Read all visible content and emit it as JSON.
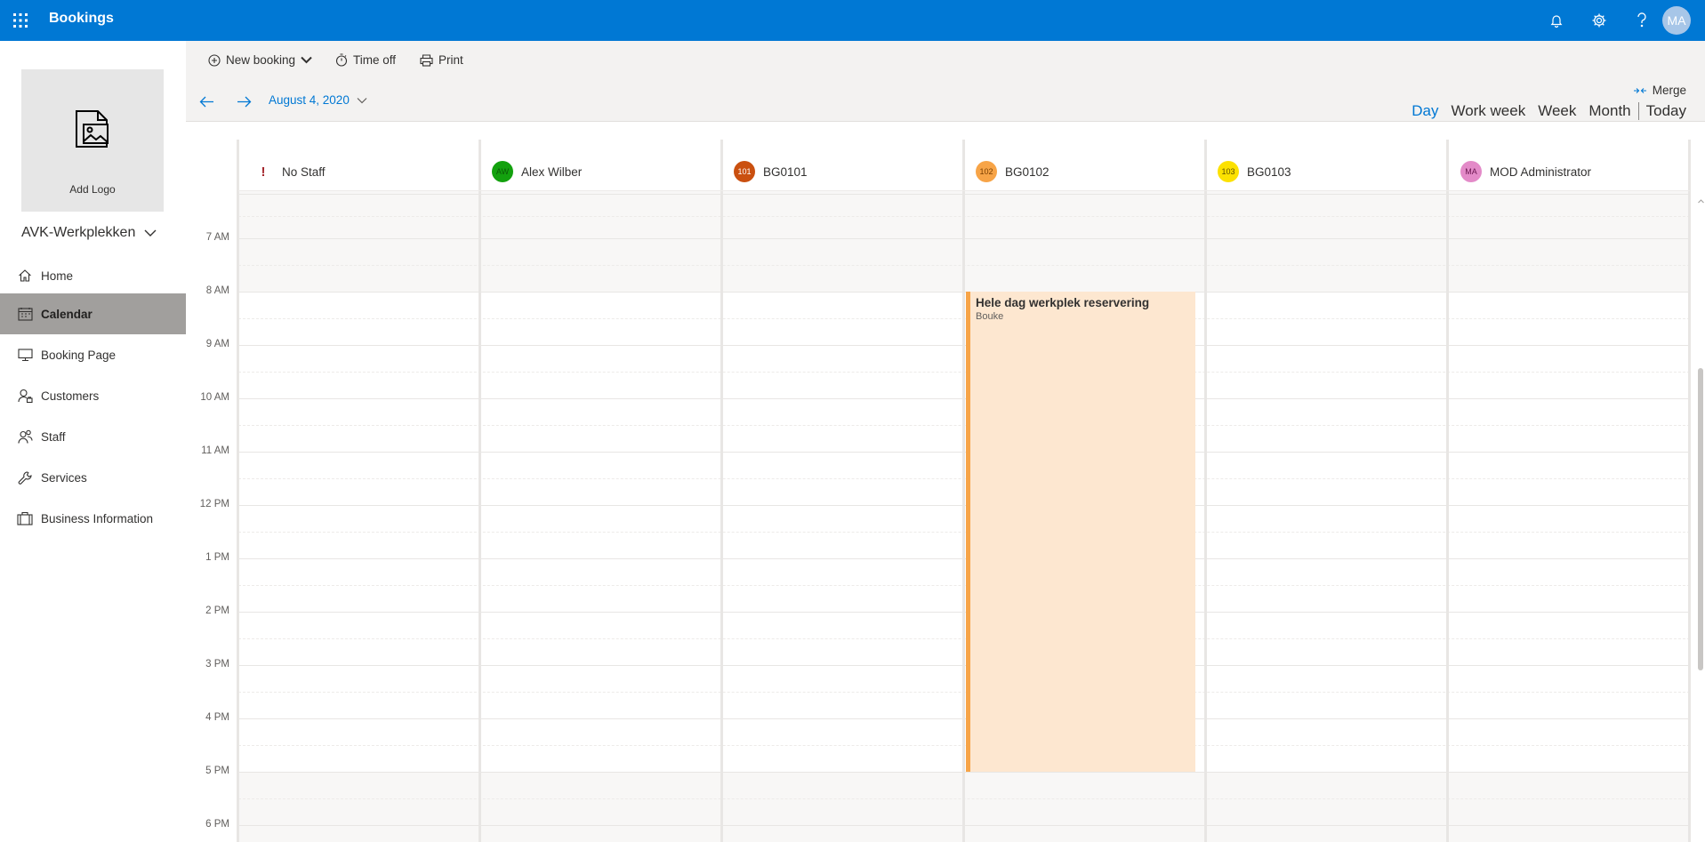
{
  "topbar": {
    "app_title": "Bookings",
    "avatar_initials": "MA",
    "brand_color": "#0078d4"
  },
  "sidebar": {
    "add_logo_label": "Add Logo",
    "business_name": "AVK-Werkplekken",
    "items": [
      {
        "label": "Home",
        "icon": "home-icon"
      },
      {
        "label": "Calendar",
        "icon": "calendar-icon",
        "active": true
      },
      {
        "label": "Booking Page",
        "icon": "monitor-icon"
      },
      {
        "label": "Customers",
        "icon": "customers-icon"
      },
      {
        "label": "Staff",
        "icon": "staff-icon"
      },
      {
        "label": "Services",
        "icon": "wrench-icon"
      },
      {
        "label": "Business Information",
        "icon": "briefcase-icon"
      }
    ]
  },
  "commands": {
    "new_booking": "New booking",
    "time_off": "Time off",
    "print": "Print"
  },
  "datebar": {
    "date": "August 4, 2020",
    "merge": "Merge",
    "views": {
      "day": "Day",
      "work_week": "Work week",
      "week": "Week",
      "month": "Month",
      "today": "Today"
    }
  },
  "calendar": {
    "columns": [
      {
        "name": "No Staff",
        "initials": "!",
        "color": "#a4262c"
      },
      {
        "name": "Alex Wilber",
        "initials": "AW",
        "color": "#13a10e"
      },
      {
        "name": "BG0101",
        "initials": "101",
        "color": "#ca5010"
      },
      {
        "name": "BG0102",
        "initials": "102",
        "color": "#f7a447"
      },
      {
        "name": "BG0103",
        "initials": "103",
        "color": "#fce100"
      },
      {
        "name": "MOD Administrator",
        "initials": "MA",
        "color": "#e38ac8"
      }
    ],
    "times": [
      "7 AM",
      "8 AM",
      "9 AM",
      "10 AM",
      "11 AM",
      "12 PM",
      "1 PM",
      "2 PM",
      "3 PM",
      "4 PM",
      "5 PM",
      "6 PM"
    ],
    "event": {
      "title": "Hele dag werkplek reservering",
      "customer": "Bouke",
      "staff": "BG0102",
      "start": "8 AM",
      "end": "5 PM",
      "color": "#f7a447"
    }
  }
}
